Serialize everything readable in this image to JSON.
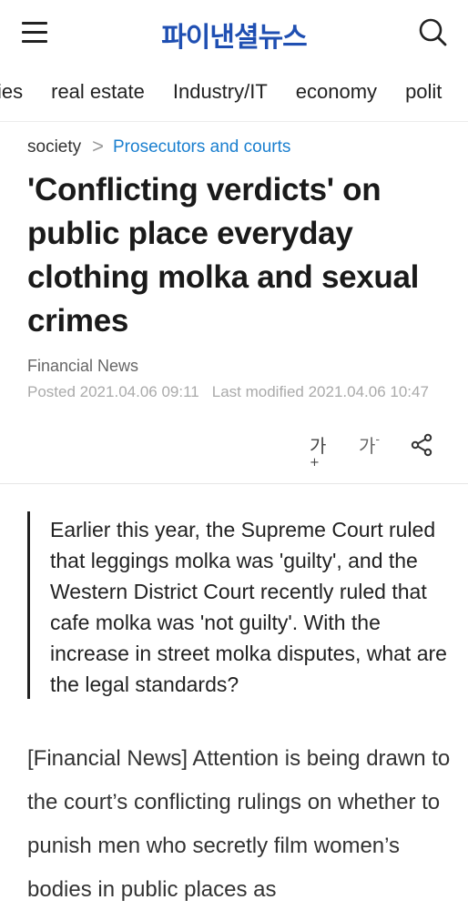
{
  "header": {
    "logo_text": "파이낸셜뉴스",
    "menu_icon": "hamburger-menu-icon",
    "search_icon": "search-icon",
    "brand_color": "#1f4fb2"
  },
  "nav": {
    "items": [
      {
        "label": "ities"
      },
      {
        "label": "real estate"
      },
      {
        "label": "Industry/IT"
      },
      {
        "label": "economy"
      },
      {
        "label": "polit"
      }
    ]
  },
  "breadcrumb": {
    "section": "society",
    "separator": ">",
    "subsection": "Prosecutors and courts",
    "link_color": "#1a7fcf"
  },
  "article": {
    "title": "'Conflicting verdicts' on public place everyday clothing molka and sexual crimes",
    "source": "Financial News",
    "posted": "Posted 2021.04.06 09:11",
    "modified": "Last modified 2021.04.06 10:47",
    "tools": {
      "increase_font": "가",
      "increase_mark": "+",
      "decrease_font": "가",
      "decrease_mark": "-",
      "share_icon": "share-icon"
    },
    "summary": "Earlier this year, the Supreme Court ruled that leggings molka was 'guilty', and the Western District Court recently ruled that cafe molka was 'not guilty'. With the increase in street molka disputes, what are the legal standards?",
    "body": "[Financial News] Attention is being drawn to the court’s conflicting rulings on whether to punish men who secretly film women’s bodies in public places as"
  }
}
